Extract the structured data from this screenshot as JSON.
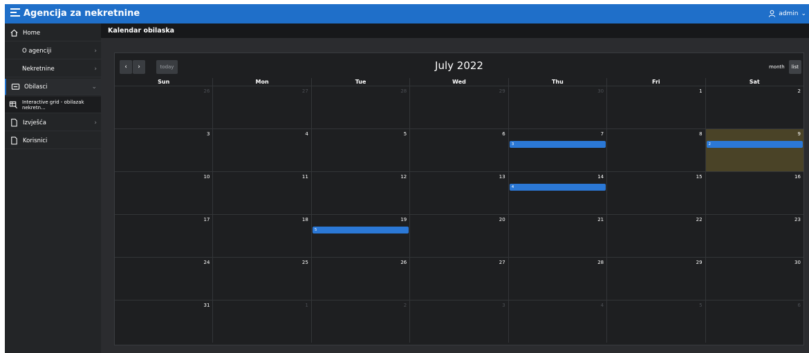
{
  "app": {
    "title": "Agencija za nekretnine",
    "user": "admin"
  },
  "sidebar": {
    "items": [
      {
        "label": "Home"
      },
      {
        "label": "O agenciji"
      },
      {
        "label": "Nekretnine"
      },
      {
        "label": "Obilasci"
      },
      {
        "label": "Interactive grid - obilazak nekretn..."
      },
      {
        "label": "Izvješća"
      },
      {
        "label": "Korisnici"
      }
    ]
  },
  "page": {
    "breadcrumb": "Kalendar obilaska"
  },
  "calendar": {
    "nav_prev": "‹",
    "nav_next": "›",
    "today_label": "today",
    "title": "July 2022",
    "views": {
      "month": "month",
      "list": "list"
    },
    "weekdays": [
      "Sun",
      "Mon",
      "Tue",
      "Wed",
      "Thu",
      "Fri",
      "Sat"
    ],
    "weeks": [
      [
        "26",
        "27",
        "28",
        "29",
        "30",
        "1",
        "2"
      ],
      [
        "3",
        "4",
        "5",
        "6",
        "7",
        "8",
        "9"
      ],
      [
        "10",
        "11",
        "12",
        "13",
        "14",
        "15",
        "16"
      ],
      [
        "17",
        "18",
        "19",
        "20",
        "21",
        "22",
        "23"
      ],
      [
        "24",
        "25",
        "26",
        "27",
        "28",
        "29",
        "30"
      ],
      [
        "31",
        "1",
        "2",
        "3",
        "4",
        "5",
        "6"
      ]
    ],
    "events": [
      {
        "label": "3",
        "date": "2022-07-07"
      },
      {
        "label": "2",
        "date": "2022-07-09"
      },
      {
        "label": "4",
        "date": "2022-07-14"
      },
      {
        "label": "5",
        "date": "2022-07-19"
      }
    ],
    "today_date": "2022-07-09",
    "colors": {
      "event": "#2b78d6",
      "today_bg": "#4a4327",
      "topbar": "#1f6fc9"
    }
  }
}
